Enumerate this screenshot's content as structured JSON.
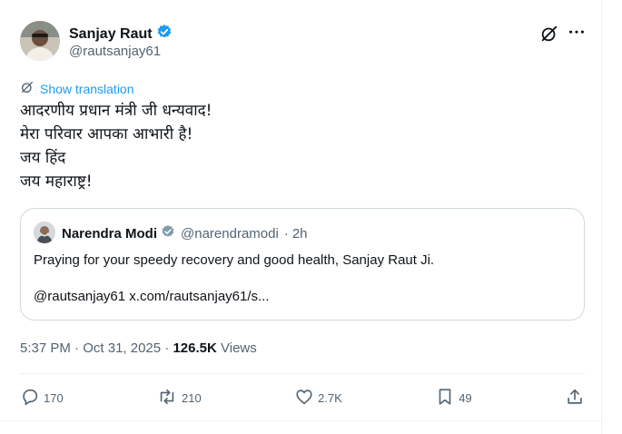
{
  "author": {
    "name": "Sanjay Raut",
    "handle": "@rautsanjay61"
  },
  "translate_label": "Show translation",
  "tweet_lines": [
    "आदरणीय प्रधान मंत्री जी धन्यवाद!",
    "मेरा परिवार आपका आभारी है!",
    "जय हिंद",
    "जय महाराष्ट्र!"
  ],
  "quote": {
    "name": "Narendra Modi",
    "handle": "@narendramodi",
    "separator": "·",
    "time": "2h",
    "text": "Praying for your speedy recovery and good health, Sanjay Raut Ji.",
    "link_text": "@rautsanjay61 x.com/rautsanjay61/s..."
  },
  "meta": {
    "time": "5:37 PM",
    "date": "Oct 31, 2025",
    "separator": "·",
    "views_count": "126.5K",
    "views_label": "Views"
  },
  "actions": {
    "replies": "170",
    "reposts": "210",
    "likes": "2.7K",
    "bookmarks": "49"
  },
  "colors": {
    "accent": "#1d9bf0",
    "muted": "#536471",
    "text": "#0f1419",
    "border": "#cfd9de"
  },
  "icons": [
    "verified-badge-icon",
    "grok-icon",
    "more-icon",
    "translate-icon",
    "reply-icon",
    "repost-icon",
    "like-icon",
    "bookmark-icon",
    "share-icon"
  ]
}
